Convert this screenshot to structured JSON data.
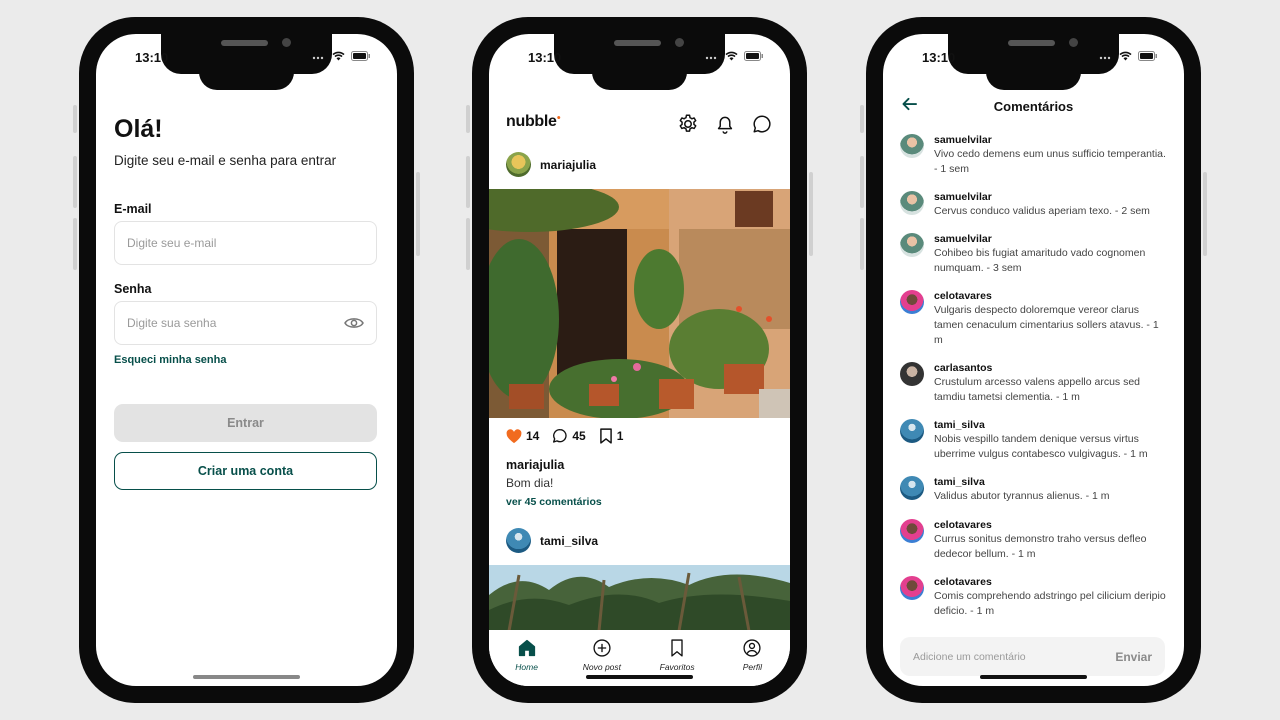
{
  "status": {
    "time": "13:10"
  },
  "login": {
    "title": "Olá!",
    "subtitle": "Digite seu e-mail e senha para entrar",
    "email_label": "E-mail",
    "email_placeholder": "Digite seu e-mail",
    "password_label": "Senha",
    "password_placeholder": "Digite sua senha",
    "forgot_link": "Esqueci minha senha",
    "enter_button": "Entrar",
    "create_account_button": "Criar uma conta"
  },
  "feed": {
    "logo": "nubble",
    "posts": [
      {
        "user": "mariajulia",
        "likes": "14",
        "comments": "45",
        "favorites": "1",
        "caption_user": "mariajulia",
        "caption": "Bom dia!",
        "view_comments": "ver 45 comentários"
      },
      {
        "user": "tami_silva"
      }
    ],
    "tabs": [
      {
        "label": "Home",
        "icon": "home-icon",
        "active": true
      },
      {
        "label": "Novo post",
        "icon": "plus-circle-icon"
      },
      {
        "label": "Favoritos",
        "icon": "bookmark-icon"
      },
      {
        "label": "Perfil",
        "icon": "profile-icon"
      }
    ],
    "accent": "#074f4a",
    "like_color": "#f16b1f"
  },
  "comments": {
    "title": "Comentários",
    "items": [
      {
        "user": "samuelvilar",
        "text": "Vivo cedo demens eum unus sufficio temperantia. - 1 sem"
      },
      {
        "user": "samuelvilar",
        "text": "Cervus conduco validus aperiam texo. - 2 sem"
      },
      {
        "user": "samuelvilar",
        "text": "Cohibeo bis fugiat amaritudo vado cognomen numquam. - 3 sem"
      },
      {
        "user": "celotavares",
        "text": "Vulgaris despecto doloremque vereor clarus tamen cenaculum cimentarius sollers atavus. - 1 m"
      },
      {
        "user": "carlasantos",
        "text": "Crustulum arcesso valens appello arcus sed tamdiu tametsi clementia. - 1 m"
      },
      {
        "user": "tami_silva",
        "text": "Nobis vespillo tandem denique versus virtus uberrime vulgus contabesco vulgivagus. - 1 m"
      },
      {
        "user": "tami_silva",
        "text": "Validus abutor tyrannus alienus. - 1 m"
      },
      {
        "user": "celotavares",
        "text": "Currus sonitus demonstro traho versus defleo dedecor bellum. - 1 m"
      },
      {
        "user": "celotavares",
        "text": "Comis comprehendo adstringo pel cilicium deripio deficio. - 1 m"
      }
    ],
    "input_placeholder": "Adicione um comentário",
    "send_button": "Enviar"
  }
}
